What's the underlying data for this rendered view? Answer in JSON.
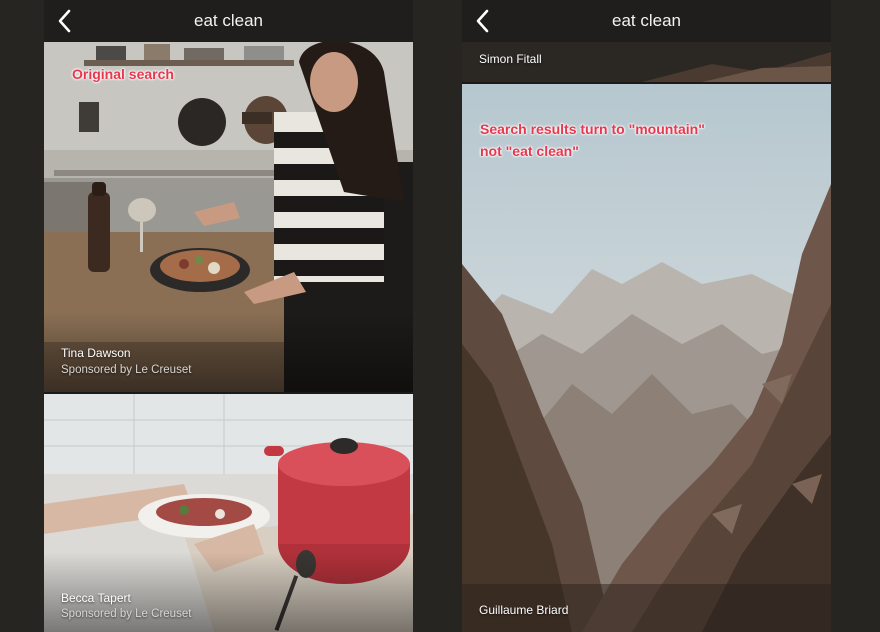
{
  "left_screen": {
    "nav": {
      "title": "eat clean",
      "back_icon": "chevron-left-icon"
    },
    "annotation": "Original search",
    "results": [
      {
        "author": "Tina Dawson",
        "sponsor": "Sponsored by Le Creuset"
      },
      {
        "author": "Becca Tapert",
        "sponsor": "Sponsored by Le Creuset"
      }
    ]
  },
  "right_screen": {
    "nav": {
      "title": "eat clean",
      "back_icon": "chevron-left-icon"
    },
    "annotation_line1": "Search results turn to \"mountain\"",
    "annotation_line2": "not \"eat clean\"",
    "results": [
      {
        "author": "Simon Fitall"
      },
      {
        "author": "Guillaume Briard"
      }
    ]
  },
  "colors": {
    "annotation": "#e8384f",
    "nav_background": "#1f1e1c",
    "page_background": "#262522"
  }
}
